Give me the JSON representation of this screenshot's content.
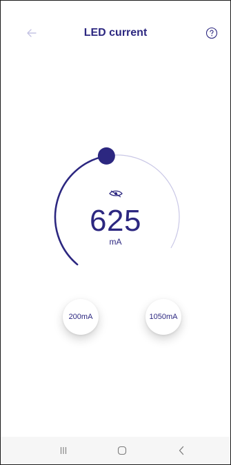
{
  "header": {
    "title": "LED current",
    "back_icon": "arrow-left-icon",
    "help_icon": "question-circle-icon"
  },
  "dial": {
    "value": "625",
    "unit": "mA",
    "min": 200,
    "max": 1050,
    "current": 625,
    "indicator_icon": "eye-icon",
    "accent_color": "#2c2780",
    "track_color": "#c9c7e6"
  },
  "presets": {
    "min_label": "200mA",
    "max_label": "1050mA"
  },
  "navbar": {
    "recents_icon": "recents-icon",
    "home_icon": "home-icon",
    "back_icon": "chevron-left-icon"
  }
}
